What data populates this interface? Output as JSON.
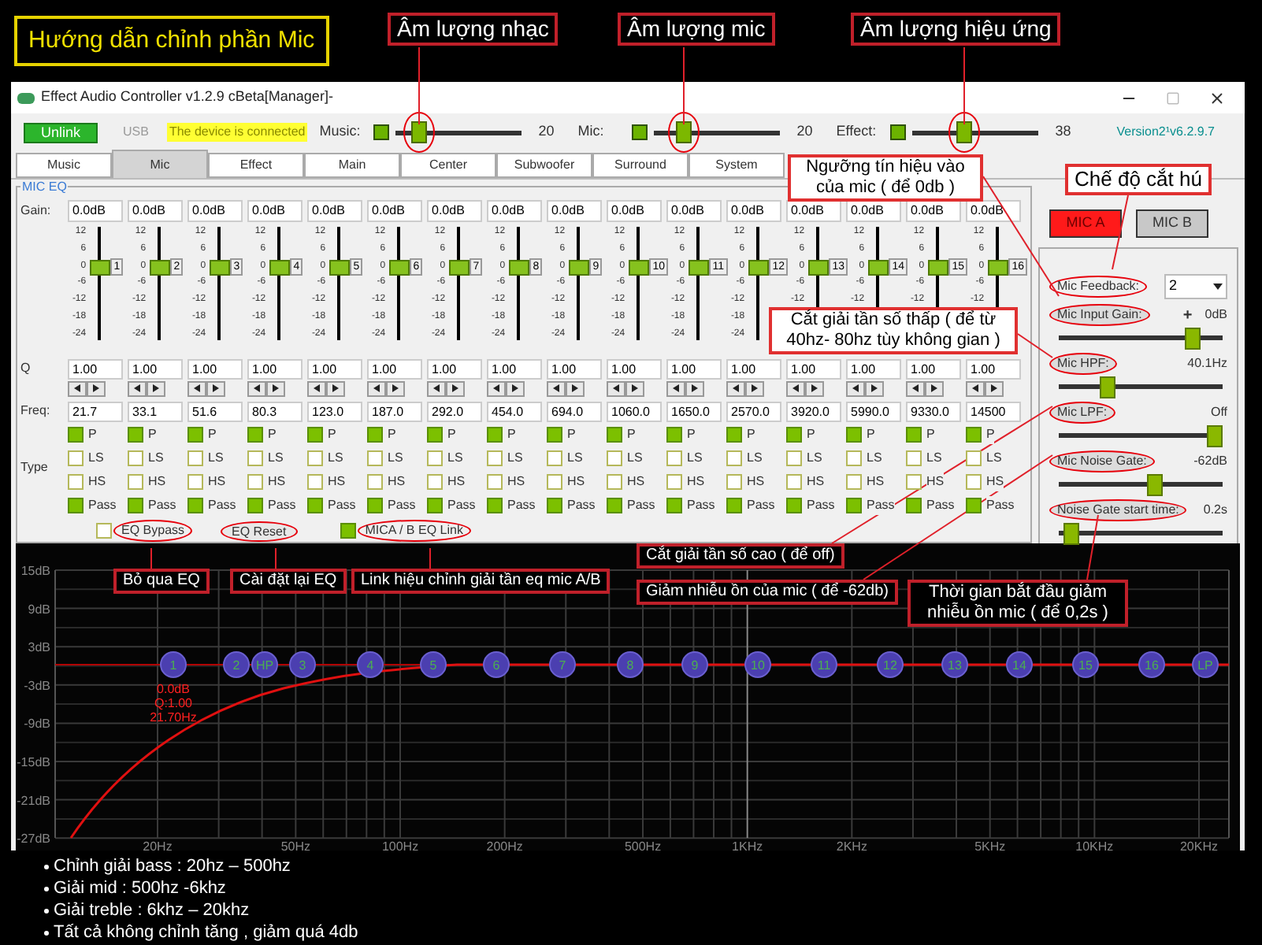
{
  "guide_title": "Hướng dẫn chỉnh phần Mic",
  "callouts": [
    {
      "text": "Âm lượng nhạc",
      "kind": "dark"
    },
    {
      "text": "Âm lượng mic",
      "kind": "dark"
    },
    {
      "text": "Âm lượng hiệu ứng",
      "kind": "dark"
    },
    {
      "text": "Ngưỡng tín hiệu vào của mic ( để 0db )",
      "kind": "light"
    },
    {
      "text": "Chế độ cắt hú",
      "kind": "light"
    },
    {
      "text": "Cắt giải tần số thấp ( để từ 40hz- 80hz tùy không gian )",
      "kind": "light"
    },
    {
      "text": "Bỏ qua EQ",
      "kind": "dark"
    },
    {
      "text": "Cài đặt lại EQ",
      "kind": "dark"
    },
    {
      "text": "Link hiệu chỉnh giải tần eq mic A/B",
      "kind": "dark"
    },
    {
      "text": "Cắt giải tần số cao ( để off)",
      "kind": "dark"
    },
    {
      "text": "Giảm nhiễu ồn của mic ( để -62db)",
      "kind": "dark"
    },
    {
      "text": "Thời gian bắt đầu giảm nhiễu ồn mic ( để 0,2s )",
      "kind": "dark"
    }
  ],
  "window": {
    "title": "Effect Audio Controller  v1.2.9 cBeta[Manager]-"
  },
  "toolbar": {
    "unlink": "Unlink",
    "usb": "USB",
    "status": "The device is connected",
    "version": "Version2¹v6.2.9.7"
  },
  "volumes": [
    {
      "label": "Music:",
      "value": "20",
      "level": 0.15,
      "highlighted": true
    },
    {
      "label": "Mic:",
      "value": "20",
      "level": 0.2,
      "highlighted": true
    },
    {
      "label": "Effect:",
      "value": "38",
      "level": 0.4,
      "highlighted": true
    }
  ],
  "tabs": [
    {
      "label": "Music",
      "selected": false
    },
    {
      "label": "Mic",
      "selected": true
    },
    {
      "label": "Effect",
      "selected": false
    },
    {
      "label": "Main",
      "selected": false
    },
    {
      "label": "Center",
      "selected": false
    },
    {
      "label": "Subwoofer",
      "selected": false
    },
    {
      "label": "Surround",
      "selected": false
    },
    {
      "label": "System",
      "selected": false
    }
  ],
  "eq": {
    "title": "MIC EQ",
    "row_labels": {
      "gain": "Gain:",
      "q": "Q",
      "freq": "Freq:",
      "type": "Type"
    },
    "bands": [
      {
        "gain": "0.0dB",
        "scale": [
          "12",
          "6",
          "0",
          "-6",
          "-12",
          "-18",
          "-24"
        ],
        "level": 0.667,
        "number": "1",
        "q": "1.00",
        "freq": "21.7",
        "types": [
          {
            "label": "P",
            "checked": true
          },
          {
            "label": "LS",
            "checked": false
          },
          {
            "label": "HS",
            "checked": false
          },
          {
            "label": "Pass",
            "checked": true
          }
        ]
      },
      {
        "gain": "0.0dB",
        "scale": [
          "12",
          "6",
          "0",
          "-6",
          "-12",
          "-18",
          "-24"
        ],
        "level": 0.667,
        "number": "2",
        "q": "1.00",
        "freq": "33.1",
        "types": [
          {
            "label": "P",
            "checked": true
          },
          {
            "label": "LS",
            "checked": false
          },
          {
            "label": "HS",
            "checked": false
          },
          {
            "label": "Pass",
            "checked": true
          }
        ]
      },
      {
        "gain": "0.0dB",
        "scale": [
          "12",
          "6",
          "0",
          "-6",
          "-12",
          "-18",
          "-24"
        ],
        "level": 0.667,
        "number": "3",
        "q": "1.00",
        "freq": "51.6",
        "types": [
          {
            "label": "P",
            "checked": true
          },
          {
            "label": "LS",
            "checked": false
          },
          {
            "label": "HS",
            "checked": false
          },
          {
            "label": "Pass",
            "checked": true
          }
        ]
      },
      {
        "gain": "0.0dB",
        "scale": [
          "12",
          "6",
          "0",
          "-6",
          "-12",
          "-18",
          "-24"
        ],
        "level": 0.667,
        "number": "4",
        "q": "1.00",
        "freq": "80.3",
        "types": [
          {
            "label": "P",
            "checked": true
          },
          {
            "label": "LS",
            "checked": false
          },
          {
            "label": "HS",
            "checked": false
          },
          {
            "label": "Pass",
            "checked": true
          }
        ]
      },
      {
        "gain": "0.0dB",
        "scale": [
          "12",
          "6",
          "0",
          "-6",
          "-12",
          "-18",
          "-24"
        ],
        "level": 0.667,
        "number": "5",
        "q": "1.00",
        "freq": "123.0",
        "types": [
          {
            "label": "P",
            "checked": true
          },
          {
            "label": "LS",
            "checked": false
          },
          {
            "label": "HS",
            "checked": false
          },
          {
            "label": "Pass",
            "checked": true
          }
        ]
      },
      {
        "gain": "0.0dB",
        "scale": [
          "12",
          "6",
          "0",
          "-6",
          "-12",
          "-18",
          "-24"
        ],
        "level": 0.667,
        "number": "6",
        "q": "1.00",
        "freq": "187.0",
        "types": [
          {
            "label": "P",
            "checked": true
          },
          {
            "label": "LS",
            "checked": false
          },
          {
            "label": "HS",
            "checked": false
          },
          {
            "label": "Pass",
            "checked": true
          }
        ]
      },
      {
        "gain": "0.0dB",
        "scale": [
          "12",
          "6",
          "0",
          "-6",
          "-12",
          "-18",
          "-24"
        ],
        "level": 0.667,
        "number": "7",
        "q": "1.00",
        "freq": "292.0",
        "types": [
          {
            "label": "P",
            "checked": true
          },
          {
            "label": "LS",
            "checked": false
          },
          {
            "label": "HS",
            "checked": false
          },
          {
            "label": "Pass",
            "checked": true
          }
        ]
      },
      {
        "gain": "0.0dB",
        "scale": [
          "12",
          "6",
          "0",
          "-6",
          "-12",
          "-18",
          "-24"
        ],
        "level": 0.667,
        "number": "8",
        "q": "1.00",
        "freq": "454.0",
        "types": [
          {
            "label": "P",
            "checked": true
          },
          {
            "label": "LS",
            "checked": false
          },
          {
            "label": "HS",
            "checked": false
          },
          {
            "label": "Pass",
            "checked": true
          }
        ]
      },
      {
        "gain": "0.0dB",
        "scale": [
          "12",
          "6",
          "0",
          "-6",
          "-12",
          "-18",
          "-24"
        ],
        "level": 0.667,
        "number": "9",
        "q": "1.00",
        "freq": "694.0",
        "types": [
          {
            "label": "P",
            "checked": true
          },
          {
            "label": "LS",
            "checked": false
          },
          {
            "label": "HS",
            "checked": false
          },
          {
            "label": "Pass",
            "checked": true
          }
        ]
      },
      {
        "gain": "0.0dB",
        "scale": [
          "12",
          "6",
          "0",
          "-6",
          "-12",
          "-18",
          "-24"
        ],
        "level": 0.667,
        "number": "10",
        "q": "1.00",
        "freq": "1060.0",
        "types": [
          {
            "label": "P",
            "checked": true
          },
          {
            "label": "LS",
            "checked": false
          },
          {
            "label": "HS",
            "checked": false
          },
          {
            "label": "Pass",
            "checked": true
          }
        ]
      },
      {
        "gain": "0.0dB",
        "scale": [
          "12",
          "6",
          "0",
          "-6",
          "-12",
          "-18",
          "-24"
        ],
        "level": 0.667,
        "number": "11",
        "q": "1.00",
        "freq": "1650.0",
        "types": [
          {
            "label": "P",
            "checked": true
          },
          {
            "label": "LS",
            "checked": false
          },
          {
            "label": "HS",
            "checked": false
          },
          {
            "label": "Pass",
            "checked": true
          }
        ]
      },
      {
        "gain": "0.0dB",
        "scale": [
          "12",
          "6",
          "0",
          "-6",
          "-12",
          "-18",
          "-24"
        ],
        "level": 0.667,
        "number": "12",
        "q": "1.00",
        "freq": "2570.0",
        "types": [
          {
            "label": "P",
            "checked": true
          },
          {
            "label": "LS",
            "checked": false
          },
          {
            "label": "HS",
            "checked": false
          },
          {
            "label": "Pass",
            "checked": true
          }
        ]
      },
      {
        "gain": "0.0dB",
        "scale": [
          "12",
          "6",
          "0",
          "-6",
          "-12"
        ],
        "level": 0.667,
        "number": "13",
        "q": "1.00",
        "freq": "3920.0",
        "types": [
          {
            "label": "P",
            "checked": true
          },
          {
            "label": "LS",
            "checked": false
          },
          {
            "label": "HS",
            "checked": false
          },
          {
            "label": "Pass",
            "checked": true
          }
        ]
      },
      {
        "gain": "0.0dB",
        "scale": [
          "12",
          "6",
          "0",
          "-6",
          "-12"
        ],
        "level": 0.667,
        "number": "14",
        "q": "1.00",
        "freq": "5990.0",
        "types": [
          {
            "label": "P",
            "checked": true
          },
          {
            "label": "LS",
            "checked": false
          },
          {
            "label": "HS",
            "checked": false
          },
          {
            "label": "Pass",
            "checked": true
          }
        ]
      },
      {
        "gain": "0.0dB",
        "scale": [
          "12",
          "6",
          "0",
          "-6",
          "-12"
        ],
        "level": 0.667,
        "number": "15",
        "q": "1.00",
        "freq": "9330.0",
        "types": [
          {
            "label": "P",
            "checked": true
          },
          {
            "label": "LS",
            "checked": false
          },
          {
            "label": "HS",
            "checked": false
          },
          {
            "label": "Pass",
            "checked": true
          }
        ]
      },
      {
        "gain": "0.0dB",
        "scale": [
          "12",
          "6",
          "0",
          "-6",
          "-12"
        ],
        "level": 0.667,
        "number": "16",
        "q": "1.00",
        "freq": "14500",
        "types": [
          {
            "label": "P",
            "checked": true
          },
          {
            "label": "LS",
            "checked": false
          },
          {
            "label": "HS",
            "checked": false
          },
          {
            "label": "Pass",
            "checked": true
          }
        ]
      }
    ],
    "bypass": {
      "label": "EQ Bypass",
      "checked": false,
      "highlighted": true
    },
    "reset": {
      "label": "EQ Reset",
      "highlighted": true
    },
    "link": {
      "label": "MICA / B EQ Link",
      "checked": true,
      "highlighted": true
    }
  },
  "mic_select": [
    {
      "label": "MIC A",
      "selected": true
    },
    {
      "label": "MIC B",
      "selected": false
    }
  ],
  "settings": [
    {
      "kind": "dropdown",
      "label": "Mic Feedback:",
      "value": "2",
      "highlighted": true
    },
    {
      "kind": "slider",
      "label": "Mic Input Gain:",
      "button": "+",
      "reading": "0dB",
      "level": 0.85,
      "highlighted": true
    },
    {
      "kind": "slider",
      "label": "Mic HPF:",
      "reading": "40.1Hz",
      "level": 0.28,
      "highlighted": true
    },
    {
      "kind": "slider",
      "label": "Mic LPF:",
      "reading": "Off",
      "level": 1.0,
      "highlighted": true
    },
    {
      "kind": "slider",
      "label": "Mic Noise Gate:",
      "reading": "-62dB",
      "level": 0.6,
      "highlighted": true
    },
    {
      "kind": "slider",
      "label": "Noise Gate start time:",
      "reading": "0.2s",
      "level": 0.03,
      "highlighted": true
    }
  ],
  "chart": {
    "y_labels": [
      "15dB",
      "9dB",
      "3dB",
      "-3dB",
      "-9dB",
      "-15dB",
      "-21dB",
      "-27dB"
    ],
    "x_labels": [
      "20Hz",
      "50Hz",
      "100Hz",
      "200Hz",
      "500Hz",
      "1KHz",
      "2KHz",
      "5KHz",
      "10KHz",
      "20KHz"
    ],
    "nodes": [
      "1",
      "2",
      "HP",
      "3",
      "4",
      "5",
      "6",
      "7",
      "8",
      "9",
      "10",
      "11",
      "12",
      "13",
      "14",
      "15",
      "16",
      "LP"
    ],
    "node_info": [
      "0.0dB",
      "Q:1.00",
      "21.70Hz"
    ]
  },
  "notes": [
    "Chỉnh giải bass : 20hz – 500hz",
    "Giải mid : 500hz -6khz",
    "Giải treble : 6khz – 20khz",
    "Tất cả không chỉnh tăng , giảm quá 4db"
  ]
}
